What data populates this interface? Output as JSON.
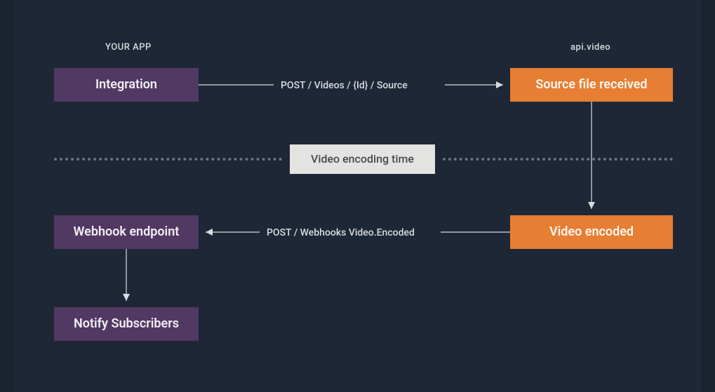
{
  "headers": {
    "left": "YOUR APP",
    "right": "api.video"
  },
  "nodes": {
    "integration": "Integration",
    "source_received": "Source file received",
    "encoding_time": "Video encoding time",
    "video_encoded": "Video encoded",
    "webhook_endpoint": "Webhook endpoint",
    "notify_subscribers": "Notify Subscribers"
  },
  "flows": {
    "post_source": "POST / Videos / {Id} / Source",
    "post_webhook": "POST / Webhooks Video.Encoded"
  },
  "colors": {
    "bg_outer": "#1b2331",
    "bg_inner": "#1e2735",
    "purple": "#513963",
    "orange": "#e67e33",
    "grey": "#e3e3e2",
    "line": "#d9dce2",
    "dotted": "#6a7383"
  }
}
